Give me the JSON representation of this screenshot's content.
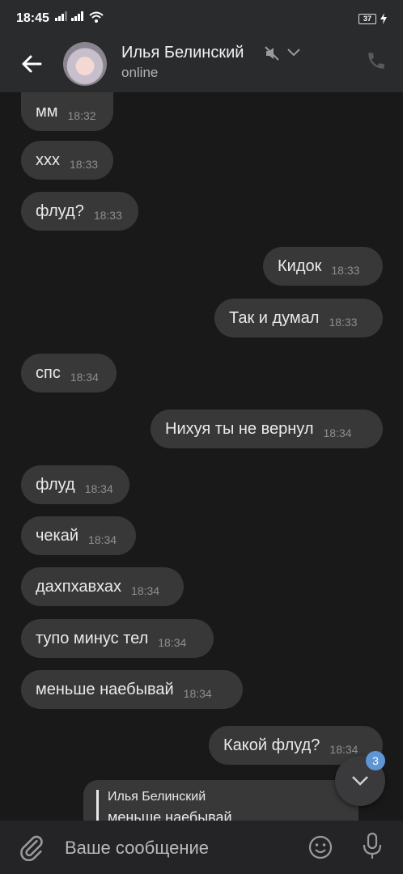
{
  "status_bar": {
    "time": "18:45",
    "battery": "37"
  },
  "header": {
    "name": "Илья Белинский",
    "status": "online"
  },
  "messages": [
    {
      "text": "мм",
      "time": "18:32",
      "out": false
    },
    {
      "text": "ххх",
      "time": "18:33",
      "out": false
    },
    {
      "text": "флуд?",
      "time": "18:33",
      "out": false
    },
    {
      "text": "Кидок",
      "time": "18:33",
      "out": true
    },
    {
      "text": "Так и думал",
      "time": "18:33",
      "out": true
    },
    {
      "text": "спс",
      "time": "18:34",
      "out": false
    },
    {
      "text": "Нихуя ты не вернул",
      "time": "18:34",
      "out": true
    },
    {
      "text": "флуд",
      "time": "18:34",
      "out": false
    },
    {
      "text": "чекай",
      "time": "18:34",
      "out": false
    },
    {
      "text": "дахпхавхах",
      "time": "18:34",
      "out": false
    },
    {
      "text": "тупо минус тел",
      "time": "18:34",
      "out": false
    },
    {
      "text": "меньше наебывай",
      "time": "18:34",
      "out": false
    },
    {
      "text": "Какой флуд?",
      "time": "18:34",
      "out": true
    }
  ],
  "reply": {
    "name": "Илья Белинский",
    "text": "меньше наебывай"
  },
  "scroll_badge": "3",
  "composer": {
    "placeholder": "Ваше сообщение"
  },
  "colors": {
    "bubble": "#383839",
    "badge": "#5e95d4",
    "background": "#19191a"
  },
  "icons": [
    "back-arrow-icon",
    "mute-icon",
    "chevron-down-icon",
    "phone-icon",
    "paperclip-icon",
    "emoji-icon",
    "mic-icon",
    "chevron-down-icon"
  ]
}
